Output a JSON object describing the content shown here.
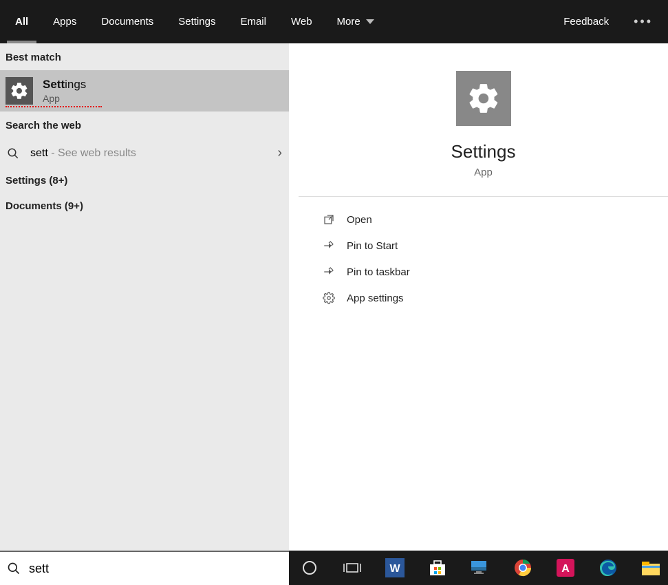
{
  "tabs": {
    "items": [
      {
        "label": "All",
        "active": true
      },
      {
        "label": "Apps",
        "active": false
      },
      {
        "label": "Documents",
        "active": false
      },
      {
        "label": "Settings",
        "active": false
      },
      {
        "label": "Email",
        "active": false
      },
      {
        "label": "Web",
        "active": false
      },
      {
        "label": "More",
        "active": false,
        "dropdown": true
      }
    ],
    "feedback": "Feedback"
  },
  "left": {
    "best_match_label": "Best match",
    "best_match": {
      "title_bold": "Sett",
      "title_rest": "ings",
      "sub": "App"
    },
    "search_web_label": "Search the web",
    "web_row": {
      "query": "sett",
      "hint": " - See web results"
    },
    "categories": [
      {
        "label": "Settings (8+)"
      },
      {
        "label": "Documents (9+)"
      }
    ]
  },
  "right": {
    "title": "Settings",
    "sub": "App",
    "actions": [
      {
        "icon": "open",
        "label": "Open"
      },
      {
        "icon": "pin-start",
        "label": "Pin to Start"
      },
      {
        "icon": "pin-taskbar",
        "label": "Pin to taskbar"
      },
      {
        "icon": "settings",
        "label": "App settings"
      }
    ]
  },
  "search": {
    "value": "sett"
  },
  "taskbar": {
    "icons": [
      "cortana",
      "taskview",
      "word",
      "store",
      "pc",
      "chrome",
      "acrobat",
      "edge",
      "explorer"
    ]
  }
}
